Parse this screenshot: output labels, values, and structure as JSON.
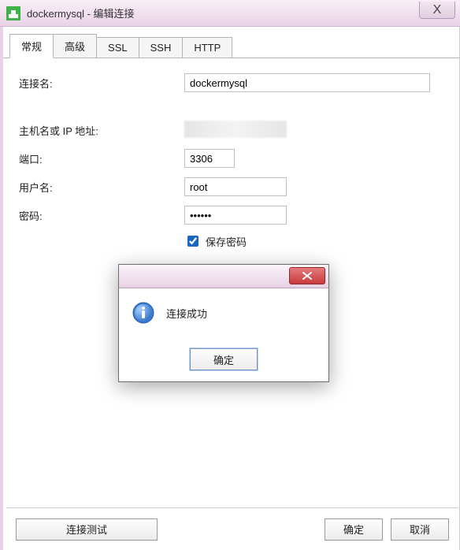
{
  "titlebar": {
    "title": "dockermysql - 编辑连接",
    "close_glyph": "X"
  },
  "tabs": [
    {
      "label": "常规",
      "active": true
    },
    {
      "label": "高级",
      "active": false
    },
    {
      "label": "SSL",
      "active": false
    },
    {
      "label": "SSH",
      "active": false
    },
    {
      "label": "HTTP",
      "active": false
    }
  ],
  "form": {
    "connection_name_label": "连接名:",
    "connection_name_value": "dockermysql",
    "host_label": "主机名或 IP 地址:",
    "host_value": "",
    "port_label": "端口:",
    "port_value": "3306",
    "user_label": "用户名:",
    "user_value": "root",
    "password_label": "密码:",
    "password_value": "••••••",
    "save_password_label": "保存密码",
    "save_password_checked": true
  },
  "modal": {
    "icon": "info-icon",
    "message": "连接成功",
    "ok_label": "确定"
  },
  "footer": {
    "test_label": "连接测试",
    "ok_label": "确定",
    "cancel_label": "取消"
  }
}
